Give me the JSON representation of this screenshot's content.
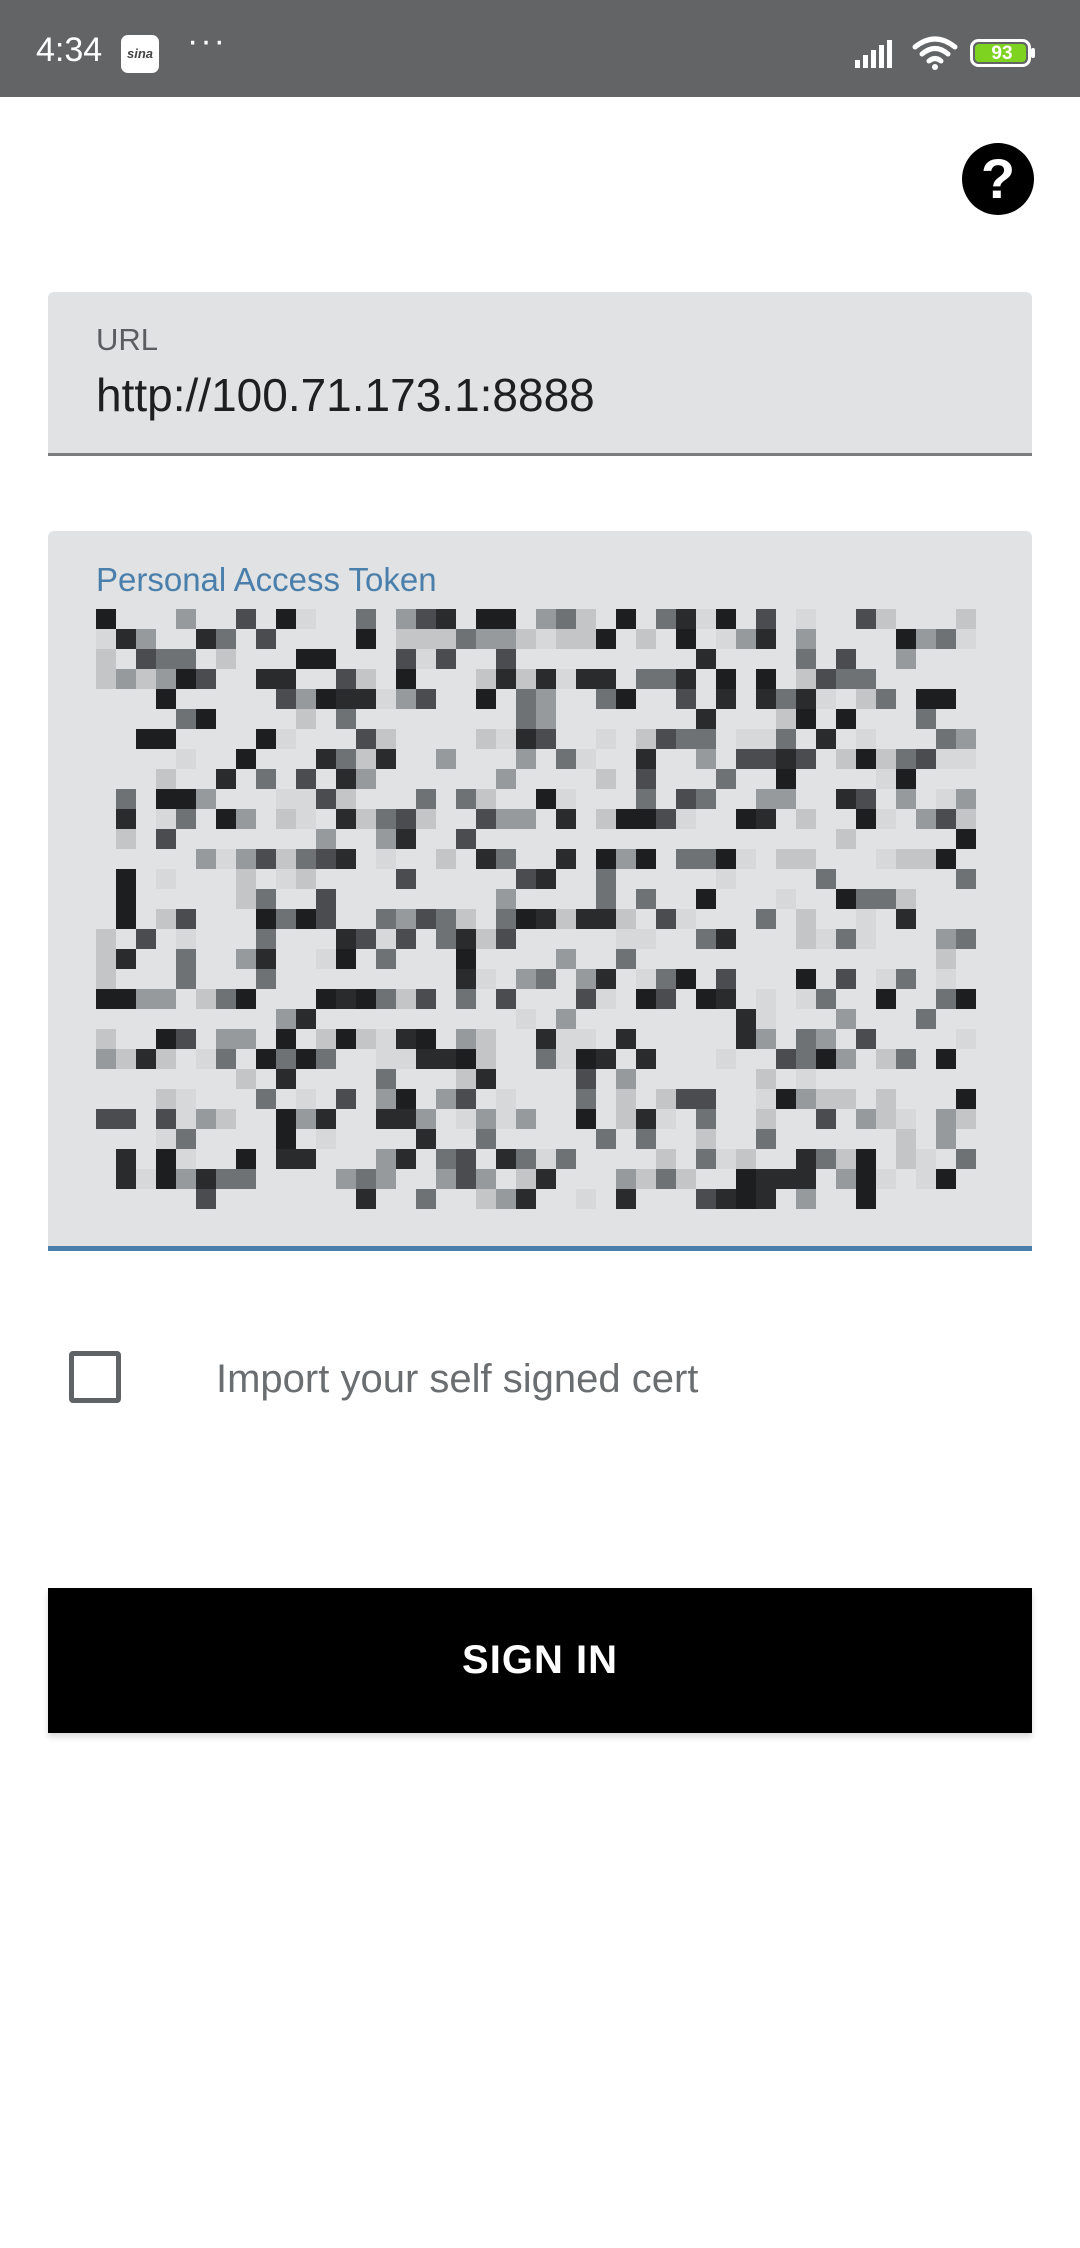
{
  "status_bar": {
    "time": "4:34",
    "app_icon": "sina-icon",
    "app_icon_text": "sina",
    "more": "···",
    "battery": "93",
    "colors": {
      "bar_bg": "#626466",
      "battery_fill": "#7ed321"
    }
  },
  "help": {
    "label": "?",
    "icon": "help-icon"
  },
  "url_field": {
    "label": "URL",
    "value": "http://100.71.173.1:8888"
  },
  "token_field": {
    "label": "Personal Access Token",
    "value_obscured": true
  },
  "self_signed_cert": {
    "label": "Import your self signed cert",
    "checked": false
  },
  "sign_in": {
    "label": "SIGN IN"
  },
  "colors": {
    "field_bg": "#e0e2e3",
    "accent": "#4a7fab",
    "button_bg": "#000000"
  }
}
